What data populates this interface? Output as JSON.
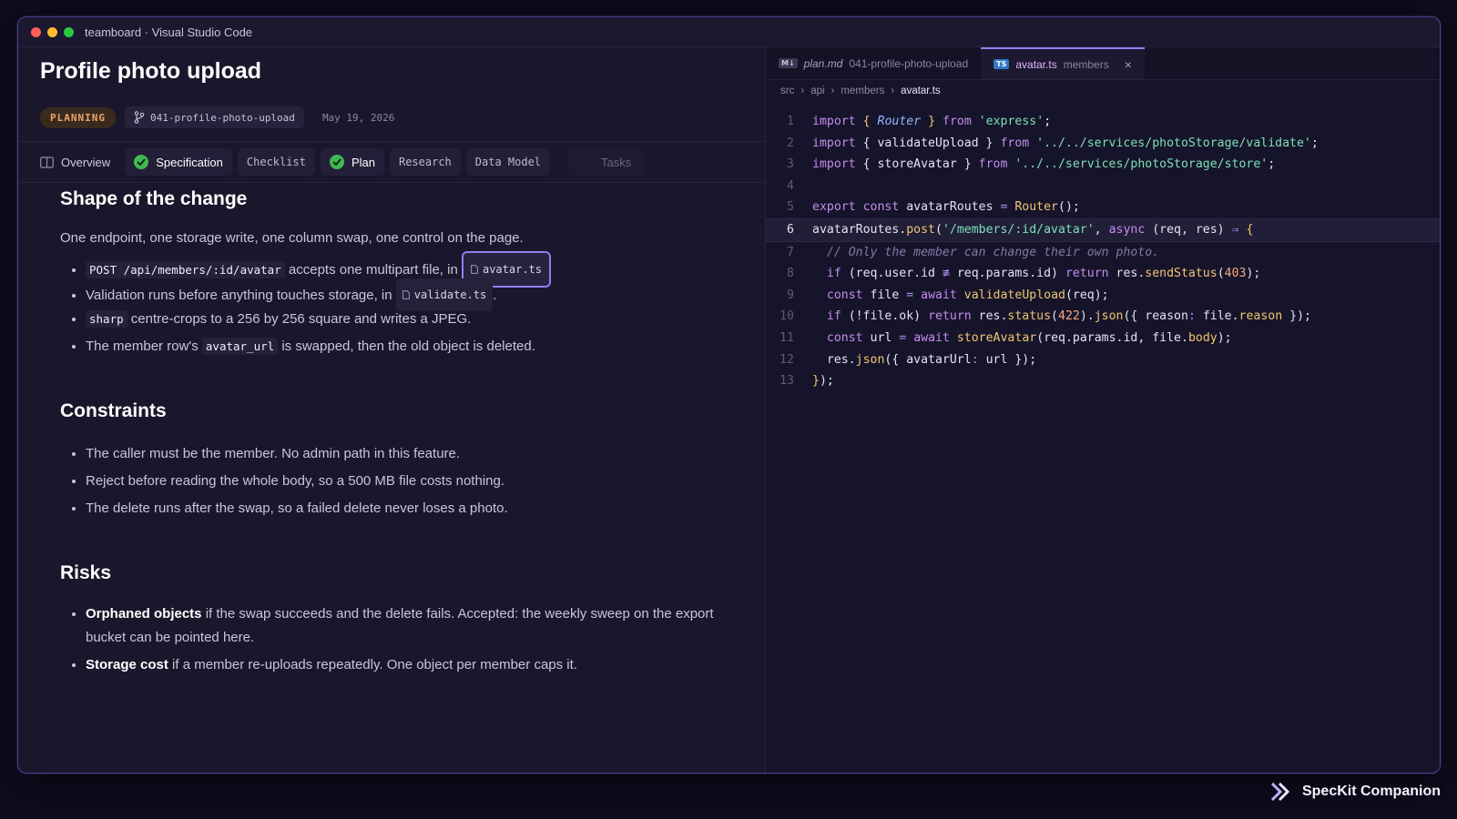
{
  "window": {
    "title": "teamboard · Visual Studio Code"
  },
  "traffic": [
    "#ff5f57",
    "#febc2e",
    "#28c840"
  ],
  "header": {
    "title": "Profile photo upload",
    "status": "PLANNING",
    "branch": "041-profile-photo-upload",
    "date": "May 19, 2026"
  },
  "tabs": [
    "Overview",
    "Specification",
    "Checklist",
    "Plan",
    "Research",
    "Data Model",
    "Tasks"
  ],
  "sections": {
    "shape": {
      "heading": "Shape of the change",
      "intro": "One endpoint, one storage write, one column swap, one control on the page.",
      "b1_code": "POST /api/members/:id/avatar",
      "b1_text": " accepts one multipart file, in ",
      "b1_file": "avatar.ts",
      "b2_text": "Validation runs before anything touches storage, in ",
      "b2_file": "validate.ts",
      "b2_end": ".",
      "b3_code": "sharp",
      "b3_text": " centre-crops to a 256 by 256 square and writes a JPEG.",
      "b4_text1": "The member row's ",
      "b4_code": "avatar_url",
      "b4_text2": " is swapped, then the old object is deleted."
    },
    "constraints": {
      "heading": "Constraints",
      "items": [
        "The caller must be the member. No admin path in this feature.",
        "Reject before reading the whole body, so a 500 MB file costs nothing.",
        "The delete runs after the swap, so a failed delete never loses a photo."
      ]
    },
    "risks": {
      "heading": "Risks",
      "r1_bold": "Orphaned objects",
      "r1_text": " if the swap succeeds and the delete fails. Accepted: the weekly sweep on the export bucket can be pointed here.",
      "r2_bold": "Storage cost",
      "r2_text": " if a member re-uploads repeatedly. One object per member caps it."
    }
  },
  "editor": {
    "tab1": {
      "icon": "M↓",
      "name": "plan.md",
      "desc": "041-profile-photo-upload"
    },
    "tab2": {
      "icon": "TS",
      "name": "avatar.ts",
      "desc": "members",
      "close": "×"
    },
    "breadcrumbs": [
      "src",
      "api",
      "members",
      "avatar.ts"
    ],
    "line_numbers": [
      "1",
      "2",
      "3",
      "4",
      "5",
      "6",
      "7",
      "8",
      "9",
      "10",
      "11",
      "12",
      "13"
    ]
  },
  "brand": {
    "name": "SpecKit Companion"
  }
}
